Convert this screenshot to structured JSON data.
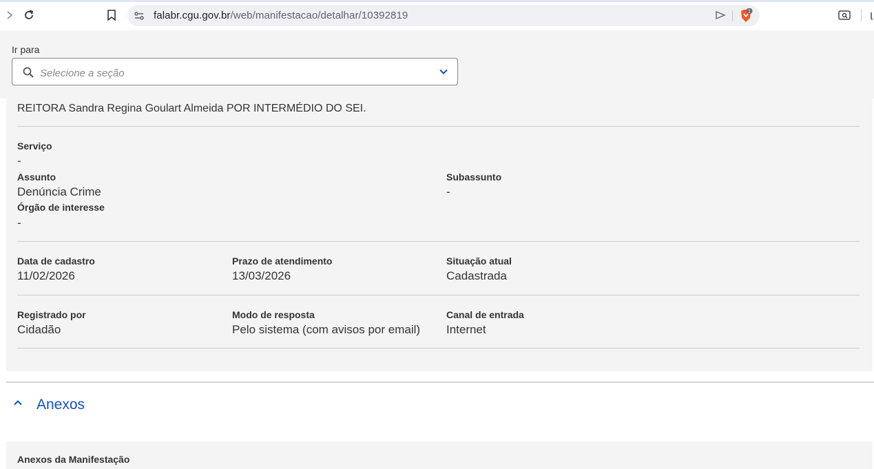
{
  "browser": {
    "url_host": "falabr.cgu.gov.br",
    "url_path": "/web/manifestacao/detalhar/10392819",
    "brave_badge": "1"
  },
  "goto": {
    "label": "Ir para",
    "placeholder": "Selecione a seção"
  },
  "details": {
    "intro": "REITORA Sandra Regina Goulart Almeida POR INTERMÉDIO DO SEI.",
    "servico": {
      "label": "Serviço",
      "value": "-"
    },
    "assunto": {
      "label": "Assunto",
      "value": "Denúncia Crime"
    },
    "subassunto": {
      "label": "Subassunto",
      "value": "-"
    },
    "orgao": {
      "label": "Órgão de interesse",
      "value": "-"
    },
    "data_cadastro": {
      "label": "Data de cadastro",
      "value": "11/02/2026"
    },
    "prazo": {
      "label": "Prazo de atendimento",
      "value": "13/03/2026"
    },
    "situacao": {
      "label": "Situação atual",
      "value": "Cadastrada"
    },
    "registrado": {
      "label": "Registrado por",
      "value": "Cidadão"
    },
    "modo": {
      "label": "Modo de resposta",
      "value": "Pelo sistema (com avisos por email)"
    },
    "canal": {
      "label": "Canal de entrada",
      "value": "Internet"
    }
  },
  "anexos": {
    "title": "Anexos",
    "subtitle": "Anexos da Manifestação"
  },
  "colors": {
    "accent": "#1351b4",
    "panel": "#f4f4f4"
  }
}
